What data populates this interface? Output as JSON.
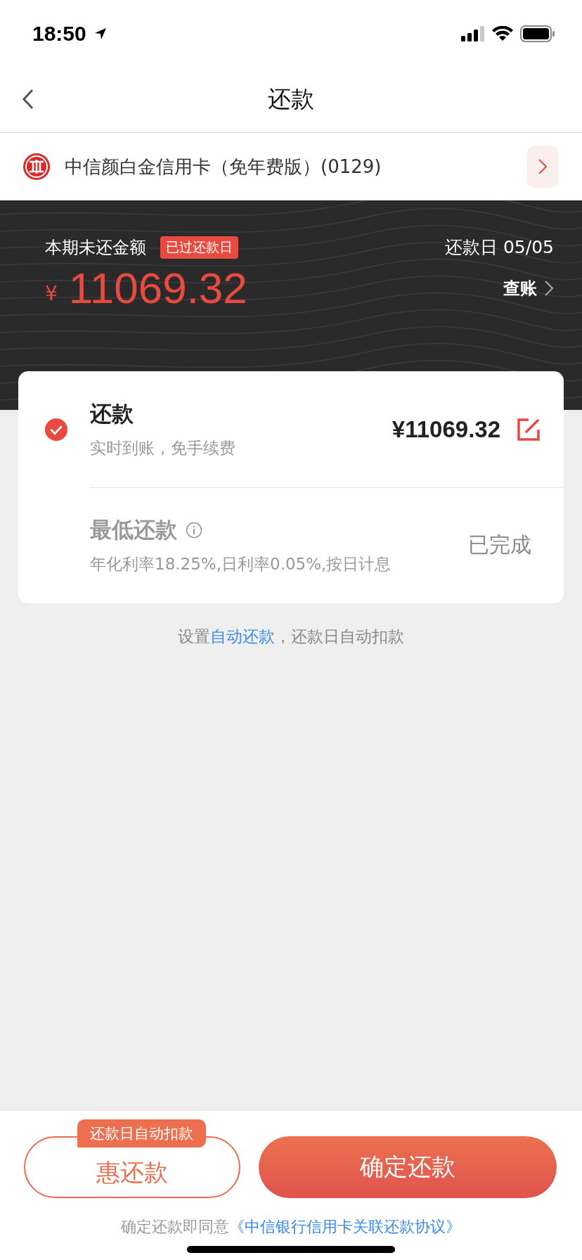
{
  "status_bar": {
    "time": "18:50"
  },
  "nav": {
    "title": "还款"
  },
  "card_selector": {
    "name": "中信颜白金信用卡（免年费版）(0129)"
  },
  "summary": {
    "label": "本期未还金额",
    "badge": "已过还款日",
    "due_date": "还款日 05/05",
    "currency": "¥",
    "amount": "11069.32",
    "statement_link": "查账"
  },
  "options": [
    {
      "kind": "amount",
      "title": "还款",
      "subtitle": "实时到账，免手续费",
      "value": "¥11069.32",
      "selected": true,
      "disabled": false,
      "info": false
    },
    {
      "kind": "status",
      "title": "最低还款",
      "subtitle": "年化利率18.25%,日利率0.05%,按日计息",
      "value": "已完成",
      "selected": false,
      "disabled": true,
      "info": true
    }
  ],
  "auto_repay": {
    "prefix": "设置",
    "link": "自动还款",
    "suffix": "，还款日自动扣款"
  },
  "buttons": {
    "secondary": {
      "label": "惠还款",
      "tag": "还款日自动扣款"
    },
    "primary": {
      "label": "确定还款"
    }
  },
  "agreement": {
    "prefix": "确定还款即同意",
    "link": "《中信银行信用卡关联还款协议》"
  }
}
